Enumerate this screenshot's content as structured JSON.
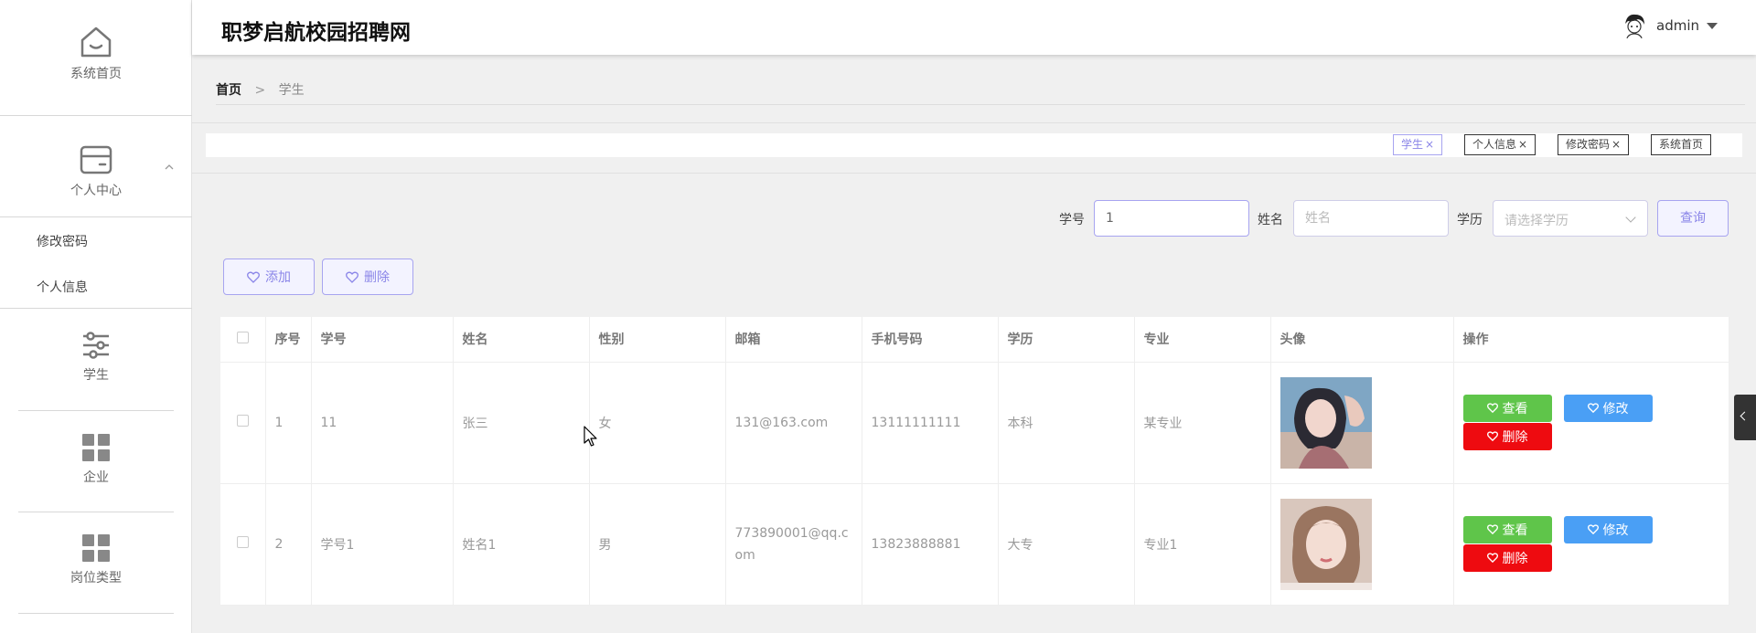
{
  "site": {
    "title": "职梦启航校园招聘网"
  },
  "user": {
    "name": "admin"
  },
  "sidebar": {
    "home_label": "系统首页",
    "personal_label": "个人中心",
    "personal_items": [
      "修改密码",
      "个人信息"
    ],
    "items": [
      {
        "label": "学生",
        "icon": "sliders-icon"
      },
      {
        "label": "企业",
        "icon": "grid-icon"
      },
      {
        "label": "岗位类型",
        "icon": "grid-icon"
      }
    ]
  },
  "breadcrumb": {
    "home": "首页",
    "separator": ">",
    "current": "学生"
  },
  "tags": [
    {
      "label": "学生",
      "active": true,
      "close": "×"
    },
    {
      "label": "个人信息",
      "active": false,
      "close": "×"
    },
    {
      "label": "修改密码",
      "active": false,
      "close": "×"
    },
    {
      "label": "系统首页",
      "active": false,
      "close": ""
    }
  ],
  "search": {
    "student_no_label": "学号",
    "student_no_value": "1",
    "name_label": "姓名",
    "name_placeholder": "姓名",
    "education_label": "学历",
    "education_placeholder": "请选择学历",
    "query_button": "查询"
  },
  "actions": {
    "add": "添加",
    "delete": "删除"
  },
  "table": {
    "headers": [
      "序号",
      "学号",
      "姓名",
      "性别",
      "邮箱",
      "手机号码",
      "学历",
      "专业",
      "头像",
      "操作"
    ],
    "rows": [
      {
        "index": "1",
        "student_no": "11",
        "name": "张三",
        "gender": "女",
        "email": "131@163.com",
        "phone": "13111111111",
        "education": "本科",
        "major": "某专业"
      },
      {
        "index": "2",
        "student_no": "学号1",
        "name": "姓名1",
        "gender": "男",
        "email": "773890001@qq.com",
        "phone": "13823888881",
        "education": "大专",
        "major": "专业1"
      }
    ],
    "op_view": "查看",
    "op_edit": "修改",
    "op_delete": "删除"
  },
  "colors": {
    "accent": "#8a85e8",
    "view_btn": "#5fc54a",
    "edit_btn": "#4a9ff5",
    "delete_btn": "#ee0b10"
  }
}
